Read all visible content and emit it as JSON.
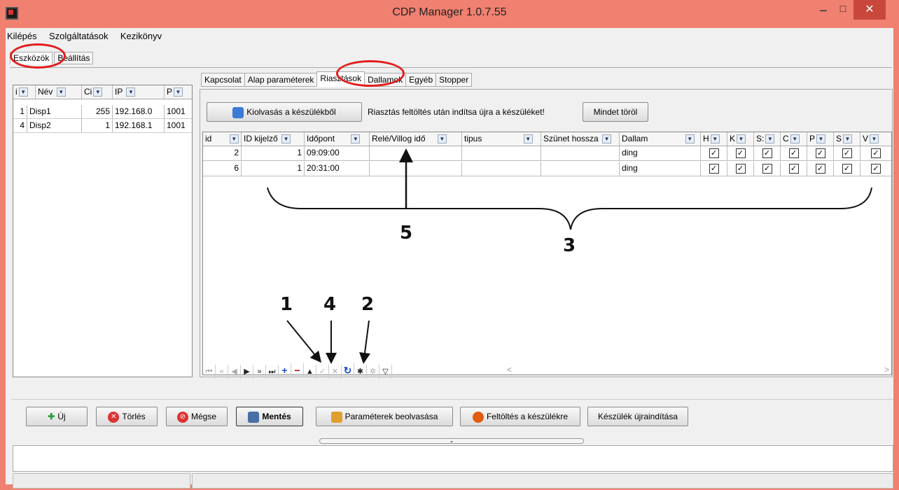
{
  "window": {
    "title": "CDP Manager 1.0.7.55",
    "min": "–",
    "max": "□",
    "close": "✕"
  },
  "menu": [
    "Kilépés",
    "Szolgáltatások",
    "Kezikönyv"
  ],
  "top_tabs": [
    "Eszközök",
    "Beállítás"
  ],
  "left_grid": {
    "headers": [
      "i",
      "Név",
      "Ci",
      "IP",
      "P"
    ],
    "rows": [
      [
        "1",
        "Disp1",
        "255",
        "192.168.0",
        "1001"
      ],
      [
        "4",
        "Disp2",
        "1",
        "192.168.1",
        "1001"
      ]
    ]
  },
  "inner_tabs": [
    "Kapcsolat",
    "Alap paraméterek",
    "Riasztások",
    "Dallamok",
    "Egyéb",
    "Stopper"
  ],
  "read_button": "Kiolvasás a készülékből",
  "notice": "Riasztás feltöltés után indítsa újra a készüléket!",
  "clear_button": "Mindet töröl",
  "main_grid": {
    "headers": [
      "id",
      "ID kijelző",
      "Időpont",
      "Relé/Villog idő",
      "tipus",
      "Szünet hossza",
      "Dallam",
      "H",
      "K",
      "S:",
      "C",
      "P",
      "S",
      "V"
    ],
    "rows": [
      {
        "id": "2",
        "kijelzo": "1",
        "idopont": "09:09:00",
        "rele": "",
        "tipus": "",
        "szunet": "",
        "dallam": "ding",
        "days": [
          true,
          true,
          true,
          true,
          true,
          true,
          true
        ]
      },
      {
        "id": "6",
        "kijelzo": "1",
        "idopont": "20:31:00",
        "rele": "",
        "tipus": "",
        "szunet": "",
        "dallam": "ding",
        "days": [
          true,
          true,
          true,
          true,
          true,
          true,
          true
        ]
      }
    ],
    "check": "✓"
  },
  "navigator": [
    "⏮",
    "«",
    "◀",
    "▶",
    "»",
    "⏭",
    "+",
    "−",
    "▲",
    "✓",
    "✕",
    "↻",
    "✱",
    "✲",
    "▽"
  ],
  "hscroll": {
    "left": "<",
    "right": ">"
  },
  "bottom_buttons": [
    "Új",
    "Törlés",
    "Mégse",
    "Mentés",
    "Paraméterek beolvasása",
    "Feltöltés a készülékre",
    "Készülék újraindítása"
  ],
  "splitter": "⌄",
  "annotations": {
    "n1": "1",
    "n2": "2",
    "n3": "3",
    "n4": "4",
    "n5": "5"
  },
  "colors": {
    "titlebar": "#f08070",
    "close": "#c7483a",
    "ring": "#e41b1b"
  }
}
